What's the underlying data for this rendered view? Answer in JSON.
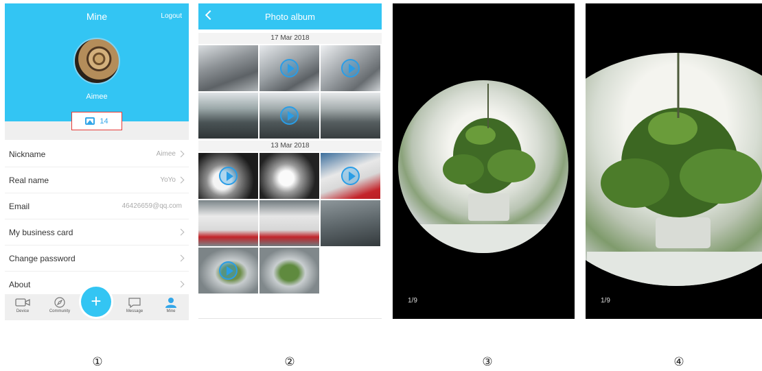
{
  "profile": {
    "title": "Mine",
    "logout_label": "Logout",
    "user_name": "Aimee",
    "photo_count": "14",
    "rows": [
      {
        "label": "Nickname",
        "value": "Aimee"
      },
      {
        "label": "Real name",
        "value": "YoYo"
      },
      {
        "label": "Email",
        "value": "46426659@qq.com"
      },
      {
        "label": "My business card",
        "value": ""
      },
      {
        "label": "Change password",
        "value": ""
      },
      {
        "label": "About",
        "value": ""
      }
    ],
    "tabs": {
      "device": "Device",
      "community": "Community",
      "add": "+",
      "message": "Message",
      "mine": "Mine"
    }
  },
  "album": {
    "title": "Photo album",
    "dates": [
      "17 Mar 2018",
      "13 Mar 2018"
    ]
  },
  "viewer3": {
    "counter": "1/9"
  },
  "viewer4": {
    "counter": "1/9"
  },
  "markers": [
    "①",
    "②",
    "③",
    "④"
  ],
  "colors": {
    "accent": "#33c5f3",
    "highlight_border": "#e53935"
  }
}
